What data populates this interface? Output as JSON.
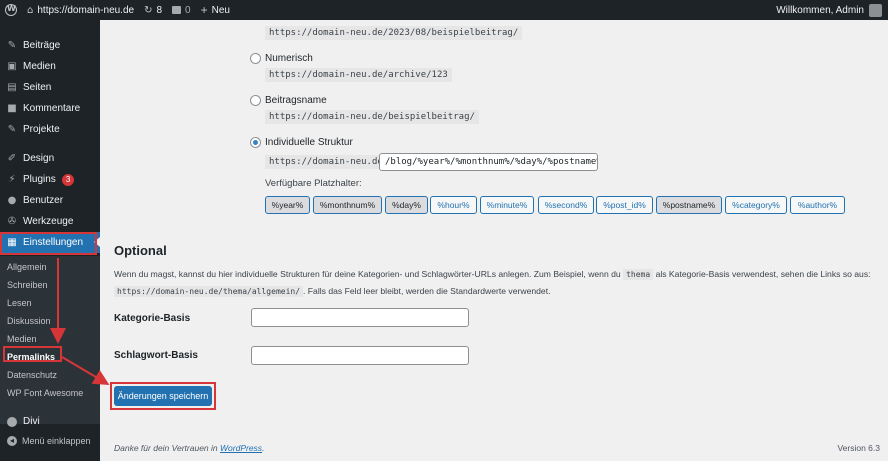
{
  "adminbar": {
    "site": "https://domain-neu.de",
    "updates": "8",
    "comments": "0",
    "new": "Neu",
    "welcome": "Willkommen, Admin"
  },
  "sidebar": {
    "items": [
      {
        "label": "Beiträge",
        "icon": "pin-icon"
      },
      {
        "label": "Medien",
        "icon": "media-icon"
      },
      {
        "label": "Seiten",
        "icon": "page-icon"
      },
      {
        "label": "Kommentare",
        "icon": "comment-icon"
      },
      {
        "label": "Projekte",
        "icon": "pin-icon"
      },
      {
        "label": "Design",
        "icon": "brush-icon"
      },
      {
        "label": "Plugins",
        "icon": "plug-icon",
        "badge": "3"
      },
      {
        "label": "Benutzer",
        "icon": "user-icon"
      },
      {
        "label": "Werkzeuge",
        "icon": "wrench-icon"
      },
      {
        "label": "Einstellungen",
        "icon": "settings-icon"
      }
    ],
    "submenu": [
      "Allgemein",
      "Schreiben",
      "Lesen",
      "Diskussion",
      "Medien",
      "Permalinks",
      "Datenschutz",
      "WP Font Awesome"
    ],
    "divi": "Divi",
    "collapse": "Menü einklappen"
  },
  "permalinks": {
    "date_example": "https://domain-neu.de/2023/08/beispielbeitrag/",
    "numeric_label": "Numerisch",
    "numeric_example": "https://domain-neu.de/archive/123",
    "postname_label": "Beitragsname",
    "postname_example": "https://domain-neu.de/beispielbeitrag/",
    "custom_label": "Individuelle Struktur",
    "custom_prefix": "https://domain-neu.de",
    "custom_value": "/blog/%year%/%monthnum%/%day%/%postname%/",
    "placeholders_label": "Verfügbare Platzhalter:",
    "placeholders": [
      "%year%",
      "%monthnum%",
      "%day%",
      "%hour%",
      "%minute%",
      "%second%",
      "%post_id%",
      "%postname%",
      "%category%",
      "%author%"
    ],
    "pressed": [
      "%year%",
      "%monthnum%",
      "%day%",
      "%postname%"
    ]
  },
  "optional": {
    "heading": "Optional",
    "desc_part1": "Wenn du magst, kannst du hier individuelle Strukturen für deine Kategorien- und Schlagwörter-URLs anlegen. Zum Beispiel, wenn du",
    "desc_code1": "thema",
    "desc_part2": "als Kategorie-Basis verwendest, sehen die Links so aus:",
    "desc_code2": "https://domain-neu.de/thema/allgemein/",
    "desc_part3": ". Falls das Feld leer bleibt, werden die Standardwerte verwendet.",
    "category_label": "Kategorie-Basis",
    "tag_label": "Schlagwort-Basis",
    "category_value": "",
    "tag_value": ""
  },
  "save_label": "Änderungen speichern",
  "footer": {
    "thanks": "Danke für dein Vertrauen in",
    "link": "WordPress",
    "period": ".",
    "version": "Version 6.3"
  },
  "colors": {
    "accent": "#2271b1",
    "highlight": "#d63638",
    "sidebar": "#1d2327"
  }
}
